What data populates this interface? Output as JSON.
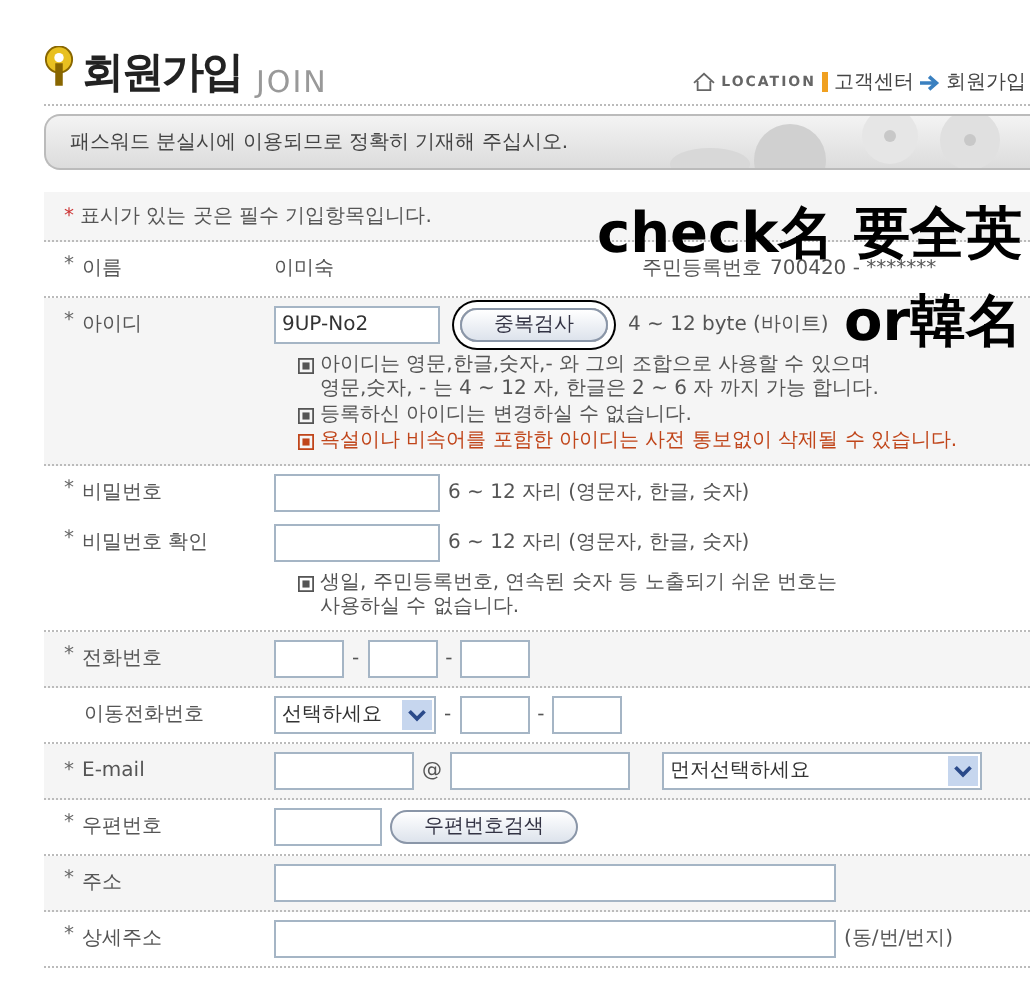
{
  "header": {
    "title": "회원가입",
    "subtitle": "JOIN",
    "location_label": "LOCATION",
    "breadcrumb": [
      "고객센터",
      "회원가입"
    ]
  },
  "notice": "패스워드 분실시에 이용되므로 정확히 기재해 주십시오.",
  "required_note": {
    "mark": "*",
    "text": "표시가 있는 곳은 필수 기입항목입니다."
  },
  "groups": [
    {
      "lines": [
        {
          "label": "이름",
          "required": true,
          "fields": [
            {
              "kind": "text",
              "text": "이미숙"
            },
            {
              "kind": "aside",
              "text": "주민등록번호"
            },
            {
              "kind": "text",
              "text": "700420 - *******"
            }
          ]
        }
      ]
    },
    {
      "lines": [
        {
          "label": "아이디",
          "required": true,
          "fields": [
            {
              "kind": "input",
              "value": "9UP-No2"
            },
            {
              "kind": "button",
              "text": "중복검사",
              "highlighted": true
            },
            {
              "kind": "text",
              "text": "4 ~ 12 byte (바이트)"
            }
          ]
        }
      ],
      "notes": [
        {
          "text": "아이디는 영문,한글,숫자,- 와 그의 조합으로 사용할 수 있으며\n영문,숫자, - 는 4 ~ 12 자, 한글은 2 ~ 6 자 까지 가능 합니다.",
          "warning": false
        },
        {
          "text": "등록하신 아이디는 변경하실 수 없습니다.",
          "warning": false
        },
        {
          "text": "욕설이나 비속어를 포함한 아이디는 사전 통보없이 삭제될 수 있습니다.",
          "warning": true
        }
      ]
    },
    {
      "lines": [
        {
          "label": "비밀번호",
          "required": true,
          "fields": [
            {
              "kind": "input"
            },
            {
              "kind": "hint",
              "text": "6 ~ 12 자리 (영문자, 한글, 숫자)"
            }
          ]
        },
        {
          "label": "비밀번호 확인",
          "required": true,
          "fields": [
            {
              "kind": "input"
            },
            {
              "kind": "hint",
              "text": "6 ~ 12 자리 (영문자, 한글, 숫자)"
            }
          ]
        }
      ],
      "notes": [
        {
          "text": "생일, 주민등록번호, 연속된 숫자 등 노출되기 쉬운 번호는\n사용하실 수 없습니다.",
          "warning": false
        }
      ]
    },
    {
      "lines": [
        {
          "label": "전화번호",
          "required": true,
          "fields": [
            {
              "kind": "tiny"
            },
            {
              "kind": "sep",
              "text": "-"
            },
            {
              "kind": "tiny"
            },
            {
              "kind": "sep",
              "text": "-"
            },
            {
              "kind": "tiny"
            }
          ]
        }
      ]
    },
    {
      "lines": [
        {
          "label": "이동전화번호",
          "required": false,
          "fields": [
            {
              "kind": "select",
              "text": "선택하세요"
            },
            {
              "kind": "sep",
              "text": "-"
            },
            {
              "kind": "tiny"
            },
            {
              "kind": "sep",
              "text": "-"
            },
            {
              "kind": "tiny"
            }
          ]
        }
      ]
    },
    {
      "lines": [
        {
          "label": "E-mail",
          "required": true,
          "fields": [
            {
              "kind": "medium"
            },
            {
              "kind": "at",
              "text": "@"
            },
            {
              "kind": "long"
            },
            {
              "kind": "wideselect",
              "text": "먼저선택하세요"
            }
          ]
        }
      ]
    },
    {
      "lines": [
        {
          "label": "우편번호",
          "required": true,
          "fields": [
            {
              "kind": "short"
            },
            {
              "kind": "button",
              "text": "우편번호검색",
              "highlighted": false
            }
          ]
        }
      ]
    },
    {
      "lines": [
        {
          "label": "주소",
          "required": true,
          "fields": [
            {
              "kind": "full"
            }
          ]
        }
      ]
    },
    {
      "lines": [
        {
          "label": "상세주소",
          "required": true,
          "fields": [
            {
              "kind": "full"
            },
            {
              "kind": "hint",
              "text": "(동/번/번지)"
            }
          ]
        }
      ]
    }
  ],
  "annotation": [
    "check名 要全英",
    "or韓名"
  ]
}
